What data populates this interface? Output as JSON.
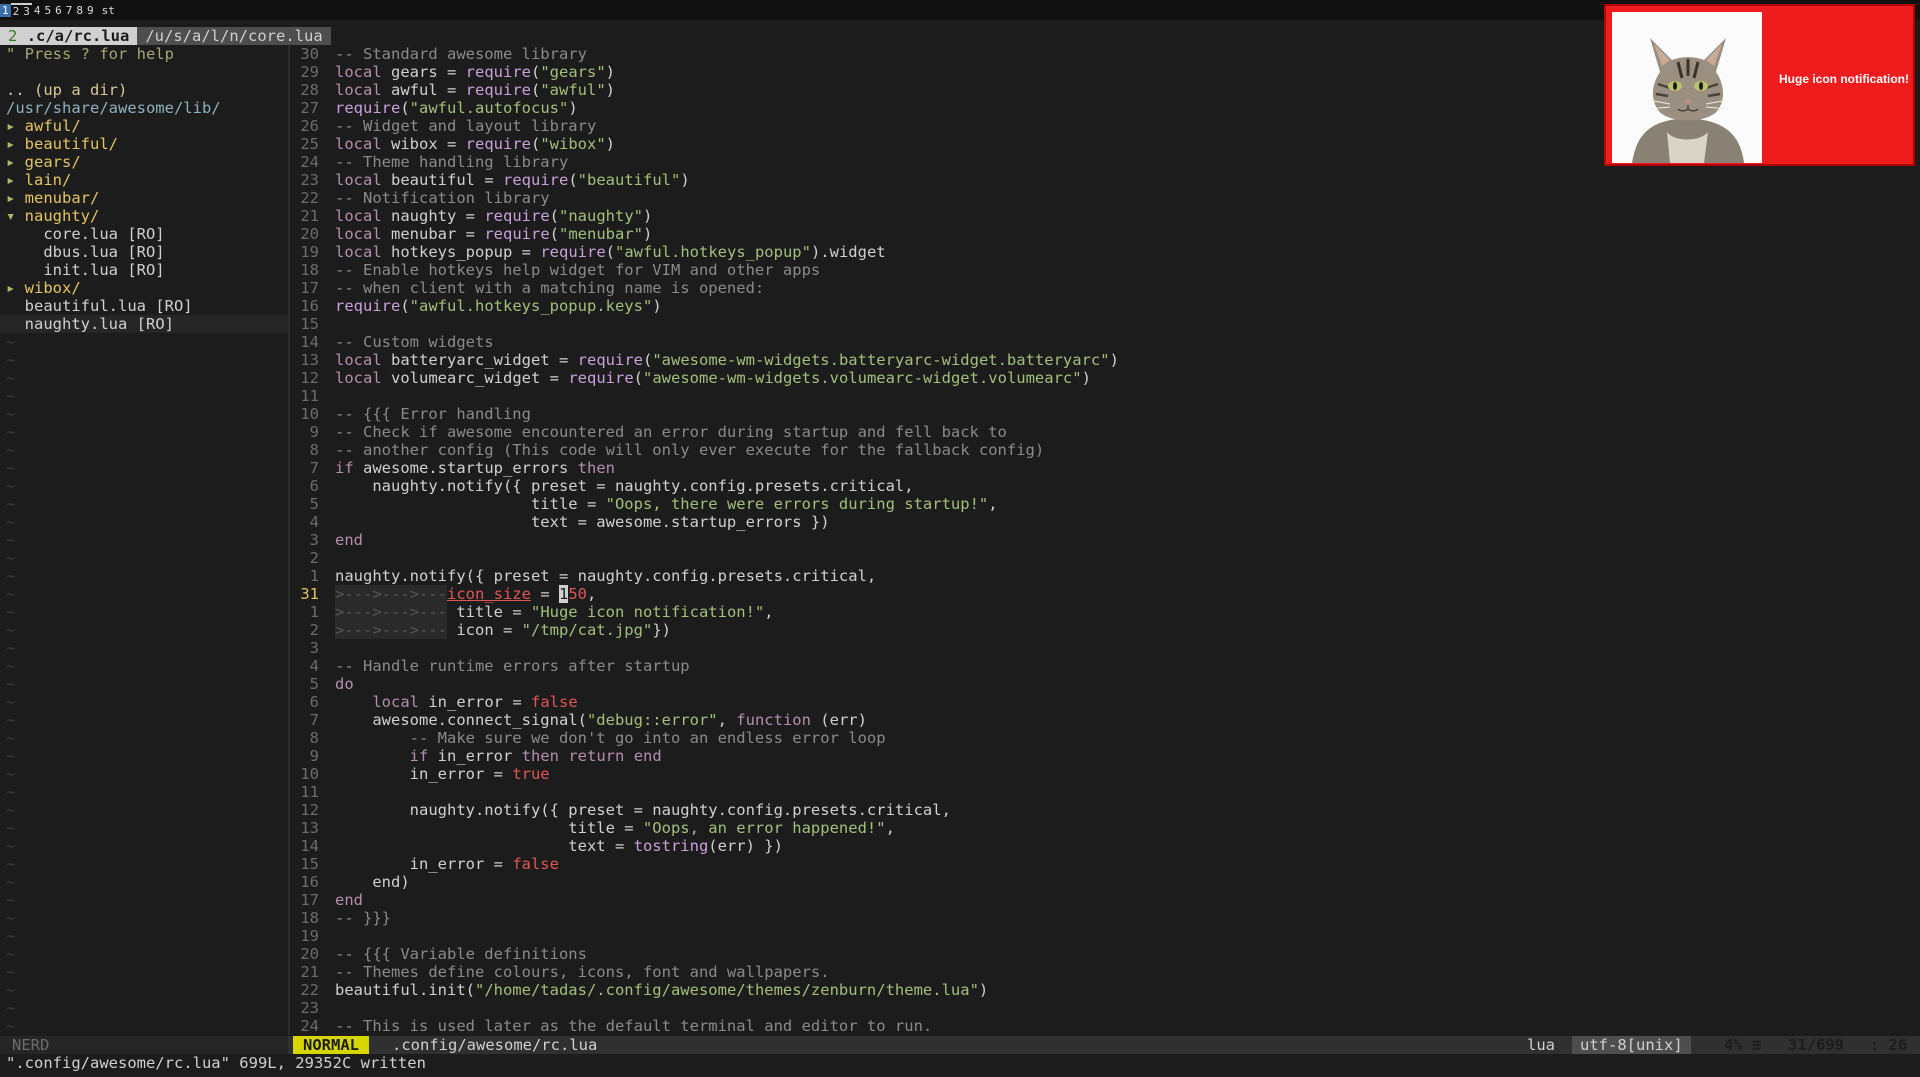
{
  "wibar": {
    "tags": [
      "1",
      "2",
      "3",
      "4",
      "5",
      "6",
      "7",
      "8",
      "9",
      "st"
    ]
  },
  "tabline": {
    "tabs": [
      {
        "num": "2",
        "label": ".c/a/rc.lua"
      },
      {
        "num": "",
        "label": "/u/s/a/l/n/core.lua"
      }
    ]
  },
  "tree": {
    "help": "\" Press ? for help",
    "updir": ".. (up a dir)",
    "root": "/usr/share/awesome/lib/",
    "items": [
      {
        "arrow": "▸ ",
        "name": "awful/",
        "type": "dir"
      },
      {
        "arrow": "▸ ",
        "name": "beautiful/",
        "type": "dir"
      },
      {
        "arrow": "▸ ",
        "name": "gears/",
        "type": "dir"
      },
      {
        "arrow": "▸ ",
        "name": "lain/",
        "type": "dir"
      },
      {
        "arrow": "▸ ",
        "name": "menubar/",
        "type": "dir"
      },
      {
        "arrow": "▾ ",
        "name": "naughty/",
        "type": "dir"
      },
      {
        "arrow": "    ",
        "name": "core.lua [RO]",
        "type": "file"
      },
      {
        "arrow": "    ",
        "name": "dbus.lua [RO]",
        "type": "file"
      },
      {
        "arrow": "    ",
        "name": "init.lua [RO]",
        "type": "file"
      },
      {
        "arrow": "▸ ",
        "name": "wibox/",
        "type": "dir"
      },
      {
        "arrow": "  ",
        "name": "beautiful.lua [RO]",
        "type": "file"
      },
      {
        "arrow": "  ",
        "name": "naughty.lua [RO]",
        "type": "file",
        "current": true
      }
    ],
    "tilde": "~"
  },
  "editor": {
    "lines": [
      {
        "n": "30",
        "t": [
          [
            "c",
            "-- Standard awesome library"
          ]
        ]
      },
      {
        "n": "29",
        "t": [
          [
            "k",
            "local"
          ],
          [
            "",
            "gears = "
          ],
          [
            "f",
            "require"
          ],
          [
            "",
            "("
          ],
          [
            "s",
            "\"gears\""
          ],
          [
            "",
            ")"
          ]
        ]
      },
      {
        "n": "28",
        "t": [
          [
            "k",
            "local"
          ],
          [
            "",
            "awful = "
          ],
          [
            "f",
            "require"
          ],
          [
            "",
            "("
          ],
          [
            "s",
            "\"awful\""
          ],
          [
            "",
            ")"
          ]
        ]
      },
      {
        "n": "27",
        "t": [
          [
            "f",
            "require"
          ],
          [
            "",
            "("
          ],
          [
            "s",
            "\"awful.autofocus\""
          ],
          [
            "",
            ")"
          ]
        ]
      },
      {
        "n": "26",
        "t": [
          [
            "c",
            "-- Widget and layout library"
          ]
        ]
      },
      {
        "n": "25",
        "t": [
          [
            "k",
            "local"
          ],
          [
            "",
            "wibox = "
          ],
          [
            "f",
            "require"
          ],
          [
            "",
            "("
          ],
          [
            "s",
            "\"wibox\""
          ],
          [
            "",
            ")"
          ]
        ]
      },
      {
        "n": "24",
        "t": [
          [
            "c",
            "-- Theme handling library"
          ]
        ]
      },
      {
        "n": "23",
        "t": [
          [
            "k",
            "local"
          ],
          [
            "",
            "beautiful = "
          ],
          [
            "f",
            "require"
          ],
          [
            "",
            "("
          ],
          [
            "s",
            "\"beautiful\""
          ],
          [
            "",
            ")"
          ]
        ]
      },
      {
        "n": "22",
        "t": [
          [
            "c",
            "-- Notification library"
          ]
        ]
      },
      {
        "n": "21",
        "t": [
          [
            "k",
            "local"
          ],
          [
            "",
            "naughty = "
          ],
          [
            "f",
            "require"
          ],
          [
            "",
            "("
          ],
          [
            "s",
            "\"naughty\""
          ],
          [
            "",
            ")"
          ]
        ]
      },
      {
        "n": "20",
        "t": [
          [
            "k",
            "local"
          ],
          [
            "",
            "menubar = "
          ],
          [
            "f",
            "require"
          ],
          [
            "",
            "("
          ],
          [
            "s",
            "\"menubar\""
          ],
          [
            "",
            ")"
          ]
        ]
      },
      {
        "n": "19",
        "t": [
          [
            "k",
            "local"
          ],
          [
            "",
            "hotkeys_popup = "
          ],
          [
            "f",
            "require"
          ],
          [
            "",
            "("
          ],
          [
            "s",
            "\"awful.hotkeys_popup\""
          ],
          [
            "",
            ").widget"
          ]
        ]
      },
      {
        "n": "18",
        "t": [
          [
            "c",
            "-- Enable hotkeys help widget for VIM and other apps"
          ]
        ]
      },
      {
        "n": "17",
        "t": [
          [
            "c",
            "-- when client with a matching name is opened:"
          ]
        ]
      },
      {
        "n": "16",
        "t": [
          [
            "f",
            "require"
          ],
          [
            "",
            "("
          ],
          [
            "s",
            "\"awful.hotkeys_popup.keys\""
          ],
          [
            "",
            ")"
          ]
        ]
      },
      {
        "n": "15",
        "t": []
      },
      {
        "n": "14",
        "t": [
          [
            "c",
            "-- Custom widgets"
          ]
        ]
      },
      {
        "n": "13",
        "t": [
          [
            "k",
            "local"
          ],
          [
            "",
            "batteryarc_widget = "
          ],
          [
            "f",
            "require"
          ],
          [
            "",
            "("
          ],
          [
            "s",
            "\"awesome-wm-widgets.batteryarc-widget.batteryarc\""
          ],
          [
            "",
            ")"
          ]
        ]
      },
      {
        "n": "12",
        "t": [
          [
            "k",
            "local"
          ],
          [
            "",
            "volumearc_widget = "
          ],
          [
            "f",
            "require"
          ],
          [
            "",
            "("
          ],
          [
            "s",
            "\"awesome-wm-widgets.volumearc-widget.volumearc\""
          ],
          [
            "",
            ")"
          ]
        ]
      },
      {
        "n": "11",
        "t": []
      },
      {
        "n": "10",
        "t": [
          [
            "c",
            "-- {{{ Error handling"
          ]
        ]
      },
      {
        "n": "9",
        "t": [
          [
            "c",
            "-- Check if awesome encountered an error during startup and fell back to"
          ]
        ]
      },
      {
        "n": "8",
        "t": [
          [
            "c",
            "-- another config (This code will only ever execute for the fallback config)"
          ]
        ]
      },
      {
        "n": "7",
        "t": [
          [
            "k",
            "if"
          ],
          [
            "",
            "awesome.startup_errors "
          ],
          [
            "k",
            "then"
          ]
        ]
      },
      {
        "n": "6",
        "t": [
          [
            "",
            "    naughty.notify({ preset = naughty.config.presets.critical,"
          ]
        ]
      },
      {
        "n": "5",
        "t": [
          [
            "",
            "                     title = "
          ],
          [
            "s",
            "\"Oops, there were errors during startup!\""
          ],
          [
            "",
            ","
          ]
        ]
      },
      {
        "n": "4",
        "t": [
          [
            "",
            "                     text = awesome.startup_errors })"
          ]
        ]
      },
      {
        "n": "3",
        "t": [
          [
            "k",
            "end"
          ]
        ]
      },
      {
        "n": "2",
        "t": []
      },
      {
        "n": "1",
        "t": [
          [
            "",
            "naughty.notify({ preset = naughty.config.presets.critical,"
          ]
        ]
      },
      {
        "n": "31",
        "cur": true,
        "t": [
          [
            "ind",
            ">--->--->---"
          ],
          [
            "",
            ""
          ],
          [
            "u",
            "icon_size"
          ],
          [
            "",
            " = "
          ],
          [
            "cursor",
            "1"
          ],
          [
            "n",
            "50"
          ],
          [
            "",
            ","
          ]
        ]
      },
      {
        "n": "1",
        "t": [
          [
            "ind",
            ">--->--->---"
          ],
          [
            "",
            "title = "
          ],
          [
            "s",
            "\"Huge icon notification!\""
          ],
          [
            "",
            ","
          ]
        ]
      },
      {
        "n": "2",
        "t": [
          [
            "ind",
            ">--->--->---"
          ],
          [
            "",
            "icon = "
          ],
          [
            "s",
            "\"/tmp/cat.jpg\""
          ],
          [
            "",
            "})"
          ]
        ]
      },
      {
        "n": "3",
        "t": []
      },
      {
        "n": "4",
        "t": [
          [
            "c",
            "-- Handle runtime errors after startup"
          ]
        ]
      },
      {
        "n": "5",
        "t": [
          [
            "k",
            "do"
          ]
        ]
      },
      {
        "n": "6",
        "t": [
          [
            "",
            "    "
          ],
          [
            "k",
            "local"
          ],
          [
            "",
            "in_error = "
          ],
          [
            "b",
            "false"
          ]
        ]
      },
      {
        "n": "7",
        "t": [
          [
            "",
            "    awesome.connect_signal("
          ],
          [
            "s",
            "\"debug::error\""
          ],
          [
            "",
            ", "
          ],
          [
            "k",
            "function"
          ],
          [
            "",
            " (err)"
          ]
        ]
      },
      {
        "n": "8",
        "t": [
          [
            "",
            "        "
          ],
          [
            "c",
            "-- Make sure we don't go into an endless error loop"
          ]
        ]
      },
      {
        "n": "9",
        "t": [
          [
            "",
            "        "
          ],
          [
            "k",
            "if"
          ],
          [
            "",
            "in_error "
          ],
          [
            "k",
            "then"
          ],
          [
            "",
            " "
          ],
          [
            "k",
            "return"
          ],
          [
            "",
            " "
          ],
          [
            "k",
            "end"
          ]
        ]
      },
      {
        "n": "10",
        "t": [
          [
            "",
            "        in_error = "
          ],
          [
            "b",
            "true"
          ]
        ]
      },
      {
        "n": "11",
        "t": []
      },
      {
        "n": "12",
        "t": [
          [
            "",
            "        naughty.notify({ preset = naughty.config.presets.critical,"
          ]
        ]
      },
      {
        "n": "13",
        "t": [
          [
            "",
            "                         title = "
          ],
          [
            "s",
            "\"Oops, an error happened!\""
          ],
          [
            "",
            ","
          ]
        ]
      },
      {
        "n": "14",
        "t": [
          [
            "",
            "                         text = "
          ],
          [
            "f",
            "tostring"
          ],
          [
            "",
            "(err) })"
          ]
        ]
      },
      {
        "n": "15",
        "t": [
          [
            "",
            "        in_error = "
          ],
          [
            "b",
            "false"
          ]
        ]
      },
      {
        "n": "16",
        "t": [
          [
            "",
            "    end)"
          ]
        ]
      },
      {
        "n": "17",
        "t": [
          [
            "k",
            "end"
          ]
        ]
      },
      {
        "n": "18",
        "t": [
          [
            "c",
            "-- }}}"
          ]
        ]
      },
      {
        "n": "19",
        "t": []
      },
      {
        "n": "20",
        "t": [
          [
            "c",
            "-- {{{ Variable definitions"
          ]
        ]
      },
      {
        "n": "21",
        "t": [
          [
            "c",
            "-- Themes define colours, icons, font and wallpapers."
          ]
        ]
      },
      {
        "n": "22",
        "t": [
          [
            "",
            "beautiful.init("
          ],
          [
            "s",
            "\"/home/tadas/.config/awesome/themes/zenburn/theme.lua\""
          ],
          [
            "",
            ")"
          ]
        ]
      },
      {
        "n": "23",
        "t": []
      },
      {
        "n": "24",
        "t": [
          [
            "c",
            "-- This is used later as the default terminal and editor to run."
          ]
        ]
      }
    ]
  },
  "statusline": {
    "nerd": "NERD",
    "mode": "NORMAL",
    "file": ".config/awesome/rc.lua",
    "filetype": "lua",
    "encoding": "utf-8[unix]",
    "percent": "4% ≡",
    "line": "31/699",
    "col": ": 26"
  },
  "cmdline": "\".config/awesome/rc.lua\" 699L, 29352C written",
  "notification": {
    "text": "Huge icon notification!",
    "icon": "cat-image",
    "bg": "#ee1c1c"
  },
  "colors": {
    "background": "#1c1c1c",
    "mode_bg": "#d7d700",
    "directory": "#e3c463",
    "string": "#a3bf7c",
    "keyword": "#b48ead"
  }
}
